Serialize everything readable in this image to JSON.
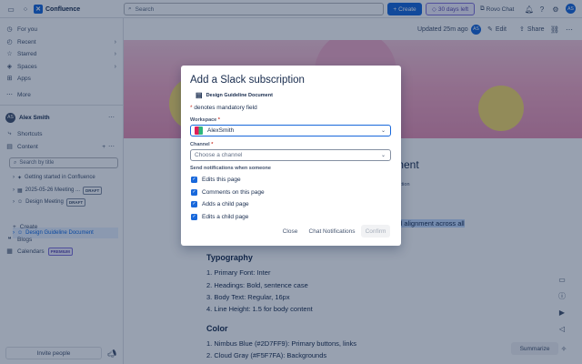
{
  "topbar": {
    "app_name": "Confluence",
    "search_placeholder": "Search",
    "create_label": "Create",
    "trial_label": "30 days left",
    "rovo_label": "Rovo Chat",
    "avatar_initials": "AS"
  },
  "sidebar": {
    "items": [
      {
        "label": "For you",
        "icon": "clock-icon"
      },
      {
        "label": "Recent",
        "icon": "recent-icon"
      },
      {
        "label": "Starred",
        "icon": "star-icon"
      },
      {
        "label": "Spaces",
        "icon": "spaces-icon"
      },
      {
        "label": "Apps",
        "icon": "apps-icon"
      }
    ],
    "more_label": "More",
    "space_name": "Alex Smith",
    "space_initials": "AS",
    "shortcuts_label": "Shortcuts",
    "content_label": "Content",
    "search_by_title": "Search by title",
    "tree": [
      {
        "label": "Getting started in Confluence",
        "badge": ""
      },
      {
        "label": "2025-05-26 Meeting ...",
        "badge": "DRAFT"
      },
      {
        "label": "Design Meeting",
        "badge": "DRAFT"
      },
      {
        "label": "Design Guideline Document",
        "badge": ""
      }
    ],
    "create_label": "Create",
    "blogs_label": "Blogs",
    "calendars_label": "Calendars",
    "premium_badge": "PREMIUM",
    "invite_label": "Invite people"
  },
  "main": {
    "updated_text": "Updated 25m ago",
    "author_initials": "AS",
    "edit_label": "Edit",
    "share_label": "Share",
    "title_partial": "ment",
    "link_partial": "rection",
    "highlight_partial": "nd alignment across all",
    "typography_heading": "Typography",
    "typography_items": [
      "1. Primary Font: Inter",
      "2. Headings: Bold, sentence case",
      "3. Body Text: Regular, 16px",
      "4. Line Height: 1.5 for body content"
    ],
    "color_heading": "Color",
    "color_items": [
      "1. Nimbus Blue (#2D7FF9): Primary buttons, links",
      "2. Cloud Gray (#F5F7FA): Backgrounds"
    ],
    "summarize_label": "Summarize"
  },
  "modal": {
    "title": "Add a Slack subscription",
    "page_name": "Design Guideline Document",
    "mandatory_note": "denotes mandatory field",
    "mandatory_star": "*",
    "workspace_label": "Workspace",
    "workspace_value": "AlexSmith",
    "channel_label": "Channel",
    "channel_placeholder": "Choose a channel",
    "notify_label": "Send notifications when someone",
    "checkboxes": [
      {
        "label": "Edits this page",
        "checked": true
      },
      {
        "label": "Comments on this page",
        "checked": true
      },
      {
        "label": "Adds a child page",
        "checked": true
      },
      {
        "label": "Edits a child page",
        "checked": true
      }
    ],
    "close_label": "Close",
    "chat_notifications_label": "Chat Notifications",
    "confirm_label": "Confirm"
  },
  "colors": {
    "accent": "#1868db",
    "overlay": "#091e42"
  }
}
